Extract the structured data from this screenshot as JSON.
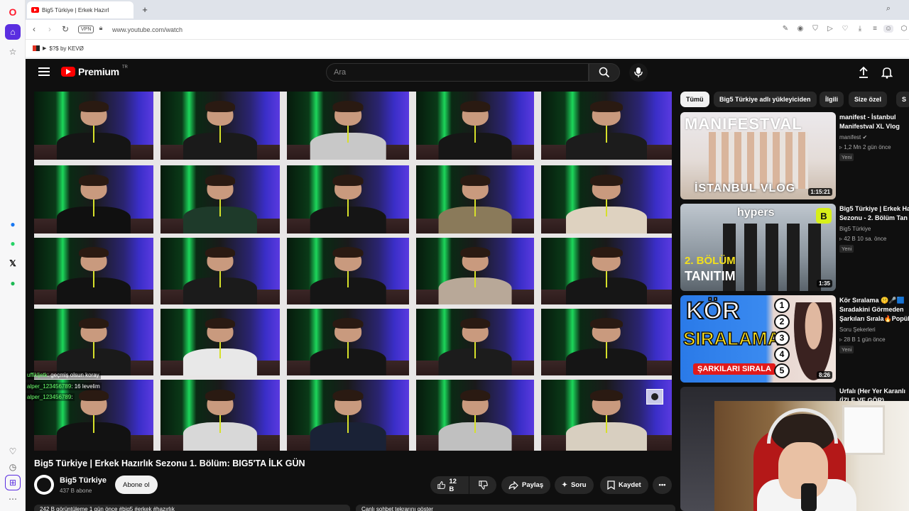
{
  "browser": {
    "tab_title": "Big5 Türkiye | Erkek Hazırl",
    "url": "www.youtube.com/watch",
    "vpn_label": "VPN",
    "bookmark": "$?$ by KEVØ"
  },
  "youtube": {
    "logo_text": "Premium",
    "logo_region": "TR",
    "search_placeholder": "Ara",
    "video": {
      "title": "Big5 Türkiye | Erkek Hazırlık Sezonu 1. Bölüm: BIG5'TA İLK GÜN",
      "channel": "Big5 Türkiye",
      "subscribers": "437 B abone",
      "subscribe_label": "Abone ol",
      "likes": "12 B",
      "share_label": "Paylaş",
      "ask_label": "Soru",
      "save_label": "Kaydet",
      "description_preview": "242 B görüntüleme  1 gün önce  #big5 #erkek #hazırlık",
      "comments_preview": "Canlı sohbet tekrarını göster"
    },
    "chat_messages": [
      {
        "user": "uffikljetk",
        "text": ": geçmiş olsun koray"
      },
      {
        "user": "alper_123456789",
        "text": ": 16 levelim"
      },
      {
        "user": "alper_123456789",
        "text": ":"
      }
    ],
    "chips": [
      {
        "label": "Tümü",
        "active": true
      },
      {
        "label": "Big5 Türkiye adlı yükleyiciden",
        "active": false
      },
      {
        "label": "İlgili",
        "active": false
      },
      {
        "label": "Size özel",
        "active": false
      },
      {
        "label": "S",
        "active": false
      }
    ],
    "recommendations": [
      {
        "title1": "manifest - İstanbul",
        "title2": "Manifestval XL Vlog",
        "channel": "manifest",
        "verified": true,
        "views": "1,2 Mn",
        "age": "2 gün önce",
        "badge": "Yeni",
        "duration": "1:15:21",
        "thumb_text": "İSTANBUL VLOG",
        "thumb_top": "MANIFESTVAL"
      },
      {
        "title1": "Big5 Türkiye | Erkek Ha",
        "title2": "Sezonu - 2. Bölüm Tan",
        "channel": "Big5 Türkiye",
        "verified": false,
        "views": "42 B",
        "age": "10 sa. önce",
        "badge": "Yeni",
        "duration": "1:35",
        "thumb_text": "2. BÖLÜM",
        "thumb_text2": "TANITIM",
        "thumb_top": "hypers"
      },
      {
        "title1": "Kör Sıralama 🤫🎤🟦",
        "title2": "Sıradakini Görmeden",
        "title3": "Şarkıları Sırala🔥Popüle",
        "channel": "Soru Şekerleri",
        "verified": false,
        "views": "28 B",
        "age": "1 gün önce",
        "badge": "Yeni",
        "duration": "8:26",
        "thumb_text": "KÖR",
        "thumb_text2": "SIRALAMA",
        "thumb_text3": "ŞARKILARI SIRALA"
      },
      {
        "title1": "Urfalı  (Her Yer Karanlı",
        "title2": "(İZLE VE GÖR)"
      }
    ]
  },
  "colors": {
    "yt_bg": "#0f0f0f",
    "yt_red": "#ff0000",
    "chip_bg": "#272727",
    "opera_red": "#ff1b2d",
    "opera_active": "#5a2ee0"
  }
}
